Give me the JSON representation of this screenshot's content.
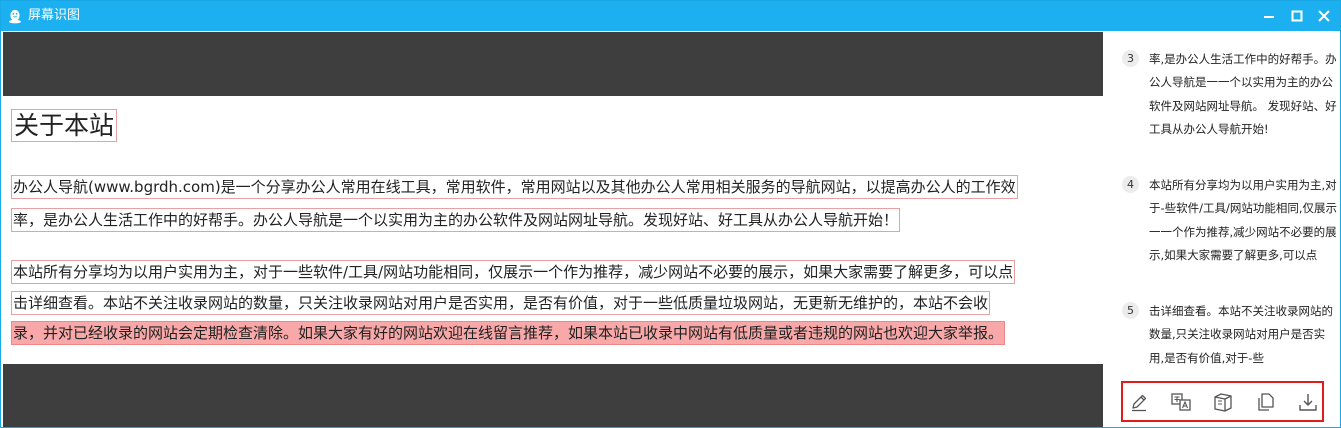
{
  "window": {
    "title": "屏幕识图",
    "icon": "qq-penguin-icon",
    "accent_color": "#1cb0f0",
    "controls": [
      "minimize-icon",
      "maximize-icon",
      "close-icon"
    ]
  },
  "document": {
    "heading": "关于本站",
    "paragraph1": [
      "办公人导航(www.bgrdh.com)是一个分享办公人常用在线工具，常用软件，常用网站以及其他办公人常用相关服务的导航网站，以提高办公人的工作效",
      "率，是办公人生活工作中的好帮手。办公人导航是一个以实用为主的办公软件及网站网址导航。发现好站、好工具从办公人导航开始！"
    ],
    "paragraph2": [
      "本站所有分享均为以用户实用为主，对于一些软件/工具/网站功能相同，仅展示一个作为推荐，减少网站不必要的展示，如果大家需要了解更多，可以点",
      "击详细查看。本站不关注收录网站的数量，只关注收录网站对用户是否实用，是否有价值，对于一些低质量垃圾网站，无更新无维护的，本站不会收",
      "录，并对已经收录的网站会定期检查清除。如果大家有好的网站欢迎在线留言推荐，如果本站已收录中网站有低质量或者违规的网站也欢迎大家举报。"
    ],
    "highlight_color": "#f8a8a8"
  },
  "results": {
    "items": [
      {
        "number": "3",
        "text": "率,是办公人生活工作中的好帮手。办公人导航是一一个以实用为主的办公软件及网站网址导航。 发现好站、好工具从办公人导航开始!"
      },
      {
        "number": "4",
        "text": "本站所有分享均为以用户实用为主,对于-些软件/工具/网站功能相同,仅展示一一个作为推荐,减少网站不必要的展示,如果大家需要了解更多,可以点"
      },
      {
        "number": "5",
        "text": "击详细查看。本站不关注收录网站的数量,只关注收录网站对用户是否实用,是否有价值,对于-些"
      }
    ]
  },
  "toolbar": {
    "tools": [
      "edit-icon",
      "translate-icon",
      "book-icon",
      "copy-icon",
      "download-icon"
    ],
    "border_color": "#e21b1b"
  }
}
